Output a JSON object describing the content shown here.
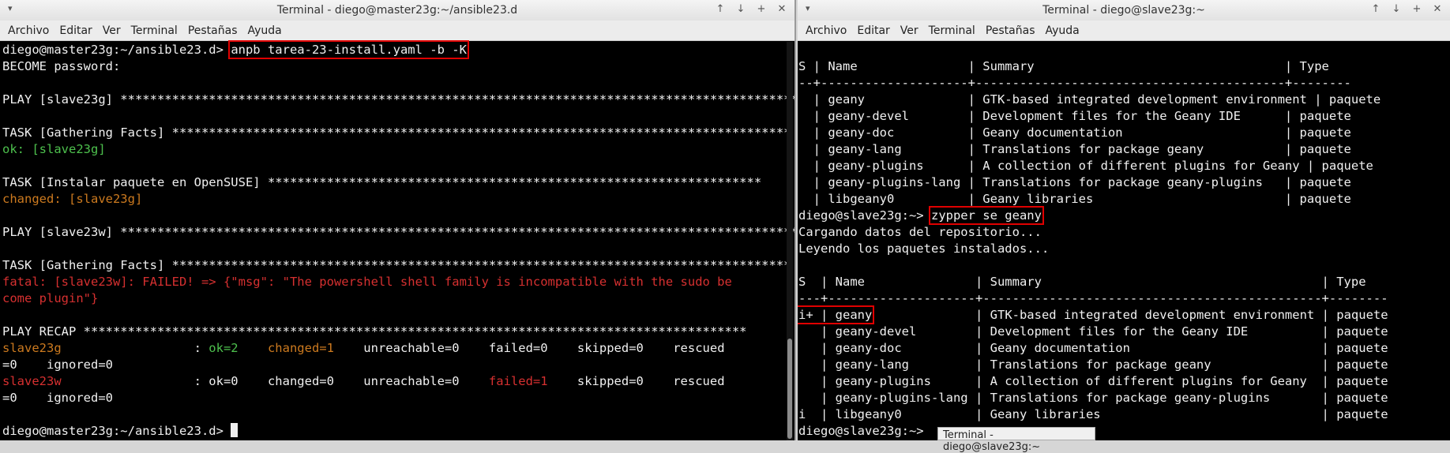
{
  "menu": [
    "Archivo",
    "Editar",
    "Ver",
    "Terminal",
    "Pestañas",
    "Ayuda"
  ],
  "left": {
    "title": "Terminal - diego@master23g:~/ansible23.d",
    "controls": [
      "↑",
      "↓",
      "+",
      "✕"
    ],
    "prompt": "diego@master23g:~/ansible23.d>",
    "command": "anpb tarea-23-install.yaml -b -K",
    "become": "BECOME password:",
    "play1": "PLAY [slave23g] **********************************************************************************************",
    "task1": "TASK [Gathering Facts] ************************************************************************************",
    "ok1": "ok: [slave23g]",
    "task2": "TASK [Instalar paquete en OpenSUSE] *******************************************************************",
    "changed1": "changed: [slave23g]",
    "play2": "PLAY [slave23w] **********************************************************************************************",
    "task3": "TASK [Gathering Facts] ************************************************************************************",
    "fatal1": "fatal: [slave23w]: FAILED! => {\"msg\": \"The powershell shell family is incompatible with the sudo be",
    "fatal2": "come plugin\"}",
    "recap": "PLAY RECAP ******************************************************************************************",
    "r1": {
      "host": "slave23g",
      "colon": "                  : ",
      "ok": "ok=2",
      "sp1": "    ",
      "changed": "changed=1",
      "rest": "    unreachable=0    failed=0    skipped=0    rescued",
      "cont": "=0    ignored=0"
    },
    "r2": {
      "host": "slave23w",
      "colon": "                  : ",
      "pre": "ok=0    changed=0    unreachable=0    ",
      "failed": "failed=1",
      "rest": "    skipped=0    rescued",
      "cont": "=0    ignored=0"
    },
    "prompt2": "diego@master23g:~/ansible23.d> "
  },
  "right": {
    "title": "Terminal - diego@slave23g:~",
    "controls": [
      "↑",
      "↓",
      "+",
      "✕"
    ],
    "table1": [
      "S | Name               | Summary                                  | Type",
      "--+--------------------+------------------------------------------+--------",
      "  | geany              | GTK-based integrated development environment | paquete",
      "  | geany-devel        | Development files for the Geany IDE      | paquete",
      "  | geany-doc          | Geany documentation                      | paquete",
      "  | geany-lang         | Translations for package geany           | paquete",
      "  | geany-plugins      | A collection of different plugins for Geany | paquete",
      "  | geany-plugins-lang | Translations for package geany-plugins   | paquete",
      "  | libgeany0          | Geany libraries                          | paquete"
    ],
    "prompt": "diego@slave23g:~>",
    "command": "zypper se geany",
    "loading1": "Cargando datos del repositorio...",
    "loading2": "Leyendo los paquetes instalados...",
    "table2_head": "S  | Name               | Summary                                      | Type",
    "table2_sep": "---+--------------------+----------------------------------------------+--------",
    "t2_first_status": "i+ | ",
    "t2_first_name": "geany",
    "t2_first_rest": "              | GTK-based integrated development environment | paquete",
    "table2_rows": [
      "   | geany-devel        | Development files for the Geany IDE          | paquete",
      "   | geany-doc          | Geany documentation                          | paquete",
      "   | geany-lang         | Translations for package geany               | paquete",
      "   | geany-plugins      | A collection of different plugins for Geany  | paquete",
      "   | geany-plugins-lang | Translations for package geany-plugins       | paquete",
      "i  | libgeany0          | Geany libraries                              | paquete"
    ],
    "prompt2": "diego@slave23g:~>",
    "tooltip": "Terminal - diego@slave23g:~"
  }
}
